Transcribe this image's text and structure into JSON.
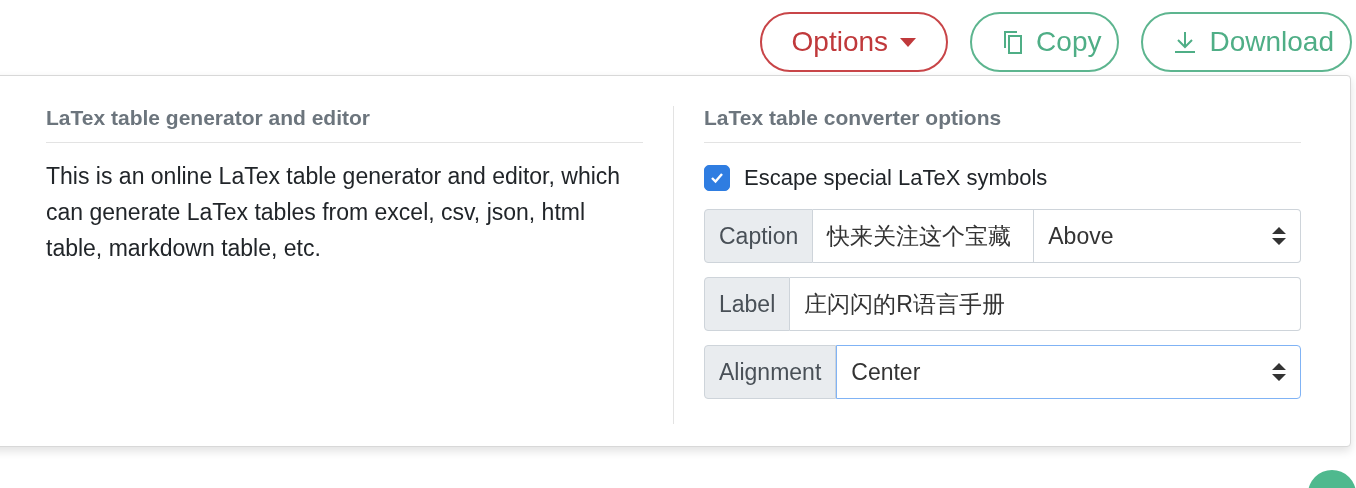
{
  "toolbar": {
    "buttons": [
      {
        "label": "Options",
        "kind": "dropdown"
      },
      {
        "label": "Copy",
        "kind": "copy"
      },
      {
        "label": "Download",
        "kind": "download"
      }
    ]
  },
  "options_panel": {
    "left": {
      "title": "LaTex table generator and editor",
      "description": "This is an online LaTex table generator and editor, which can generate LaTex tables from excel, csv, json, html table, markdown table, etc."
    },
    "right": {
      "title": "LaTex table converter options",
      "escape_checkbox": {
        "label": "Escape special LaTeX symbols",
        "checked": true
      },
      "caption": {
        "label": "Caption",
        "value": "快来关注这个宝藏",
        "position": "Above"
      },
      "label_field": {
        "label": "Label",
        "value": "庄闪闪的R语言手册"
      },
      "alignment": {
        "label": "Alignment",
        "value": "Center",
        "focused": true
      }
    }
  }
}
